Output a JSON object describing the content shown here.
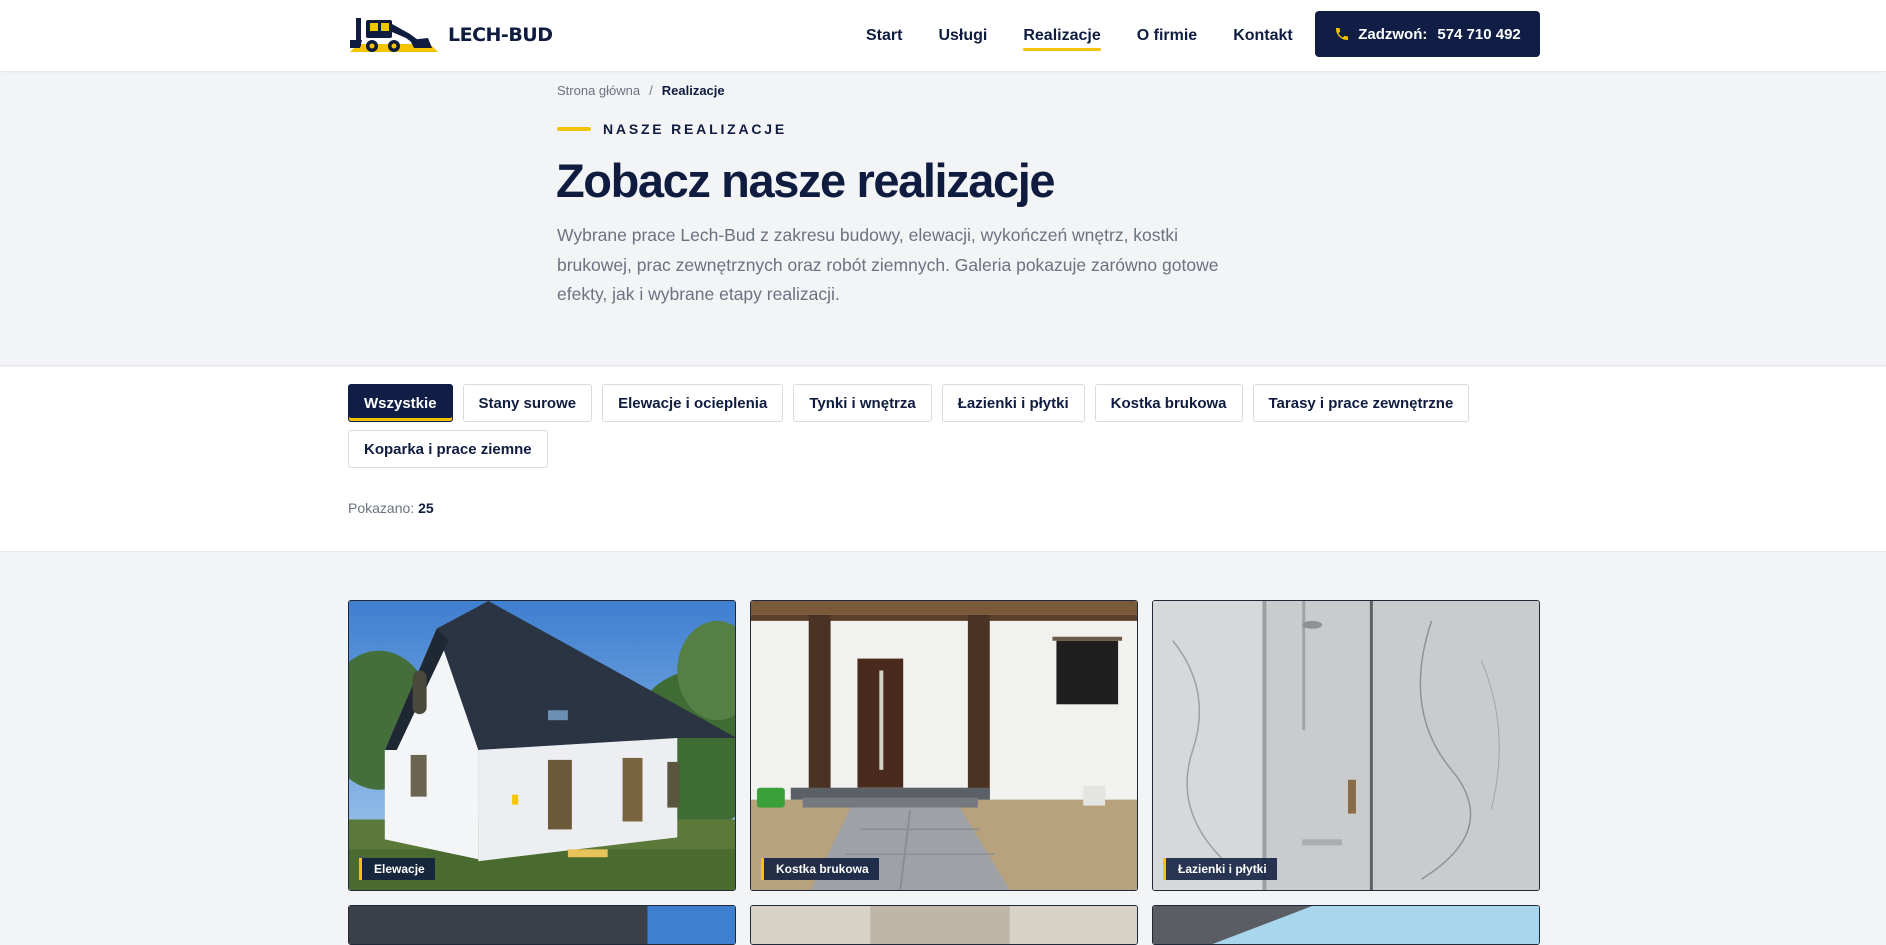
{
  "header": {
    "logo_text": "LECH-BUD",
    "nav": [
      {
        "label": "Start",
        "active": false
      },
      {
        "label": "Usługi",
        "active": false
      },
      {
        "label": "Realizacje",
        "active": true
      },
      {
        "label": "O firmie",
        "active": false
      },
      {
        "label": "Kontakt",
        "active": false
      }
    ],
    "call": {
      "label": "Zadzwoń:",
      "phone": "574 710 492",
      "icon": "phone-icon"
    }
  },
  "hero": {
    "breadcrumb": {
      "home": "Strona główna",
      "separator": "/",
      "current": "Realizacje"
    },
    "eyebrow": "NASZE REALIZACJE",
    "title": "Zobacz nasze realizacje",
    "description": "Wybrane prace Lech-Bud z zakresu budowy, elewacji, wykończeń wnętrz, kostki brukowej, prac zewnętrznych oraz robót ziemnych. Galeria pokazuje zarówno gotowe efekty, jak i wybrane etapy realizacji."
  },
  "filters": {
    "chips": [
      {
        "label": "Wszystkie",
        "active": true
      },
      {
        "label": "Stany surowe",
        "active": false
      },
      {
        "label": "Elewacje i ocieplenia",
        "active": false
      },
      {
        "label": "Tynki i wnętrza",
        "active": false
      },
      {
        "label": "Łazienki i płytki",
        "active": false
      },
      {
        "label": "Kostka brukowa",
        "active": false
      },
      {
        "label": "Tarasy i prace zewnętrzne",
        "active": false
      },
      {
        "label": "Koparka i prace ziemne",
        "active": false
      }
    ],
    "shown_label": "Pokazano:",
    "shown_count": "25"
  },
  "gallery": {
    "items": [
      {
        "tag": "Elewacje"
      },
      {
        "tag": "Kostka brukowa"
      },
      {
        "tag": "Łazienki i płytki"
      }
    ]
  },
  "colors": {
    "navy": "#101e46",
    "accent": "#f5c400",
    "muted": "#6b7280"
  }
}
